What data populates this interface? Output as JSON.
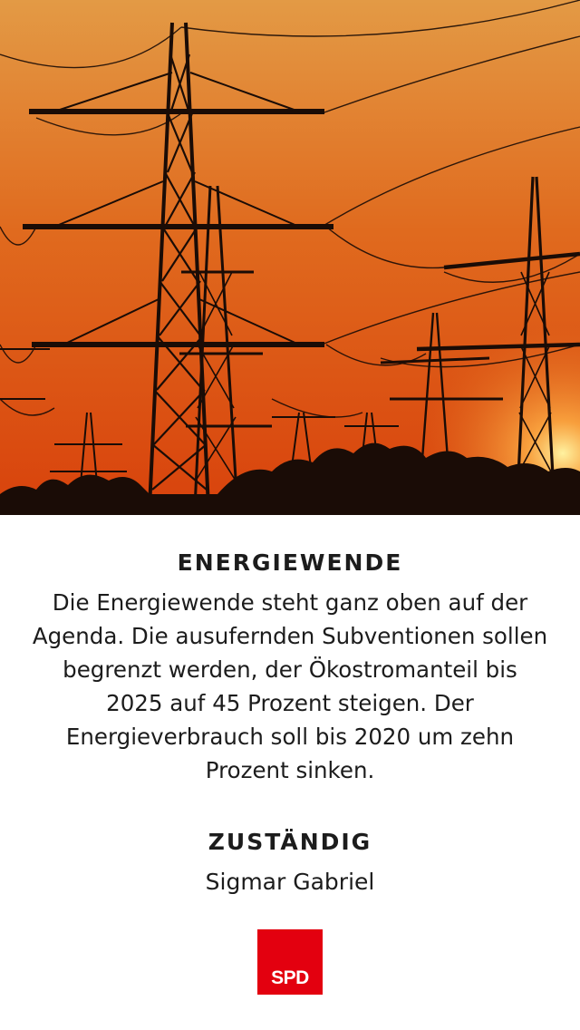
{
  "hero": {
    "image": "power-lines-sunset-photo",
    "colors": {
      "sky_top": "#e39a45",
      "sky_mid": "#e06a1e",
      "sky_low": "#d8420c",
      "sun": "#fff2a0",
      "silhouette": "#1a0c06"
    }
  },
  "sections": [
    {
      "title": "ENERGIEWENDE",
      "text": "Die Energiewende steht ganz oben auf der Agenda. Die ausufernden Subventionen sollen begrenzt werden, der Ökostromanteil bis 2025 auf 45 Prozent steigen. Der Energieverbrauch soll bis 2020 um zehn Prozent sinken."
    },
    {
      "title": "ZUSTÄNDIG",
      "text": "Sigmar Gabriel"
    }
  ],
  "logo": {
    "text": "SPD",
    "color": "#e3000f"
  }
}
